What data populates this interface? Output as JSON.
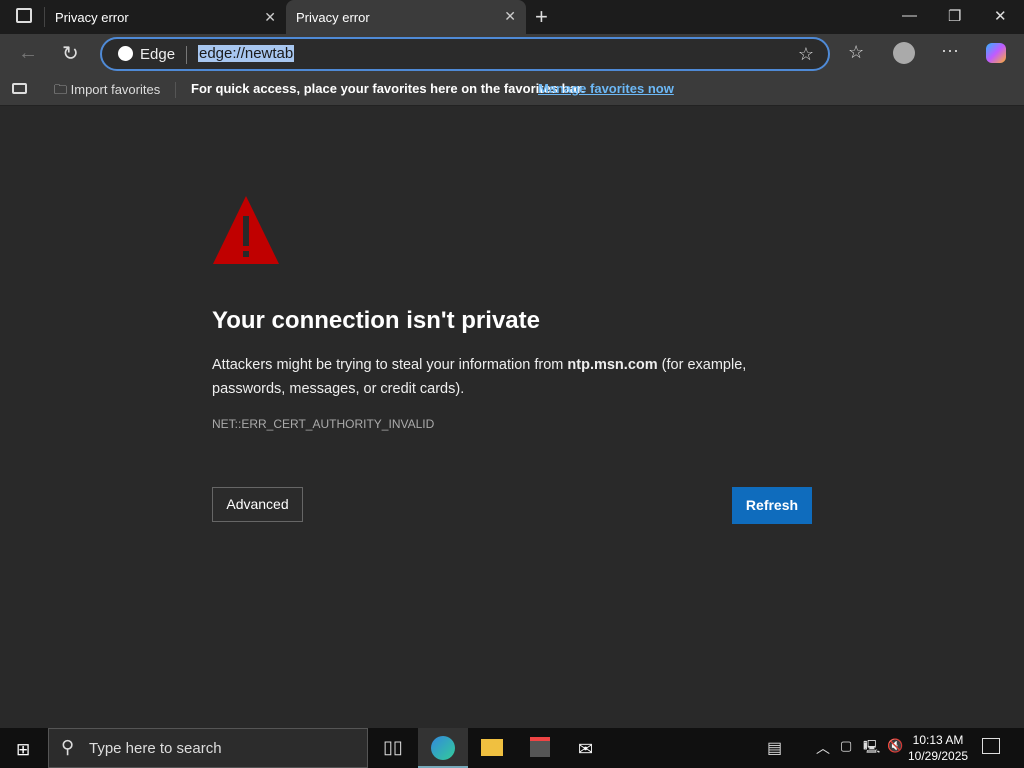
{
  "tabs": [
    {
      "label": "Privacy error"
    },
    {
      "label": "Privacy error"
    }
  ],
  "toolbar": {
    "site_label": "Edge",
    "url": "edge://newtab"
  },
  "favorites_bar": {
    "import_label": "Import favorites",
    "hint": "For quick access, place your favorites here on the favorites bar.",
    "manage_link": "Manage favorites now"
  },
  "error": {
    "title": "Your connection isn't private",
    "desc_before": "Attackers might be trying to steal your information from ",
    "host": "ntp.msn.com",
    "desc_after": " (for example, passwords, messages, or credit cards).",
    "code": "NET::ERR_CERT_AUTHORITY_INVALID",
    "advanced_label": "Advanced",
    "refresh_label": "Refresh"
  },
  "taskbar": {
    "search_placeholder": "Type here to search",
    "time": "10:13 AM",
    "date": "10/29/2025"
  },
  "colors": {
    "accent": "#0f6cbd",
    "warning": "#c00000",
    "link": "#6cb8f6"
  }
}
